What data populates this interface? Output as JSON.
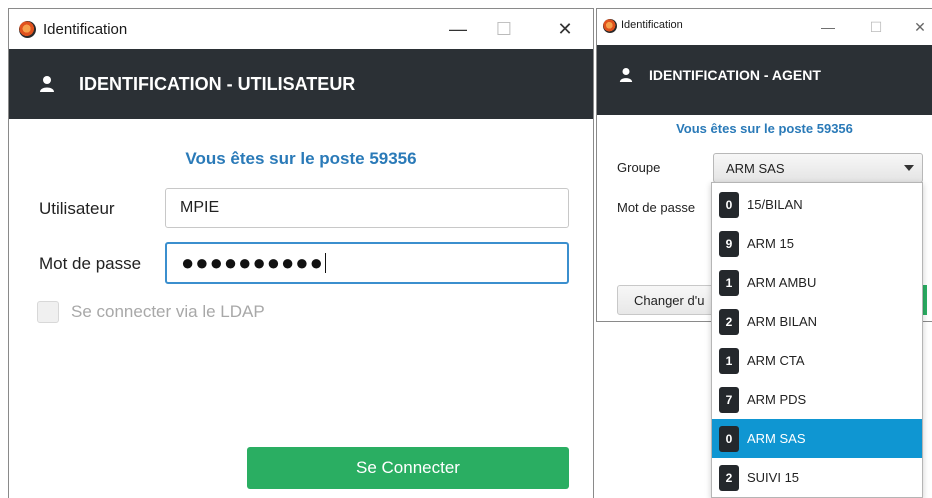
{
  "window_user": {
    "title": "Identification",
    "minimize_glyph": "—",
    "maximize_glyph": "☐",
    "close_glyph": "✕",
    "header_title": "IDENTIFICATION - UTILISATEUR",
    "poste_text": "Vous êtes sur le poste 59356",
    "user_label": "Utilisateur",
    "user_value": "MPIE",
    "password_label": "Mot de passe",
    "password_value": "●●●●●●●●●●",
    "ldap_label": "Se connecter via le LDAP",
    "ldap_checked": false,
    "connect_button": "Se Connecter"
  },
  "window_agent": {
    "title": "Identification",
    "minimize_glyph": "—",
    "maximize_glyph": "☐",
    "close_glyph": "✕",
    "header_title": "IDENTIFICATION - AGENT",
    "poste_text": "Vous êtes sur le poste 59356",
    "group_label": "Groupe",
    "group_selected": "ARM SAS",
    "password_label": "Mot de passe",
    "change_button": "Changer d'u"
  },
  "group_dropdown": {
    "options": [
      {
        "count": "0",
        "label": "15/BILAN"
      },
      {
        "count": "9",
        "label": "ARM 15"
      },
      {
        "count": "1",
        "label": "ARM AMBU"
      },
      {
        "count": "2",
        "label": "ARM BILAN"
      },
      {
        "count": "1",
        "label": "ARM CTA"
      },
      {
        "count": "7",
        "label": "ARM PDS"
      },
      {
        "count": "0",
        "label": "ARM SAS",
        "selected": true
      },
      {
        "count": "2",
        "label": "SUIVI 15"
      }
    ]
  },
  "colors": {
    "header_bg": "#2b3035",
    "accent_blue": "#2a7ab8",
    "selection_blue": "#0f96d2",
    "connect_green": "#2aae62"
  },
  "icons": {
    "app": "app-logo-icon",
    "user": "user-icon"
  }
}
